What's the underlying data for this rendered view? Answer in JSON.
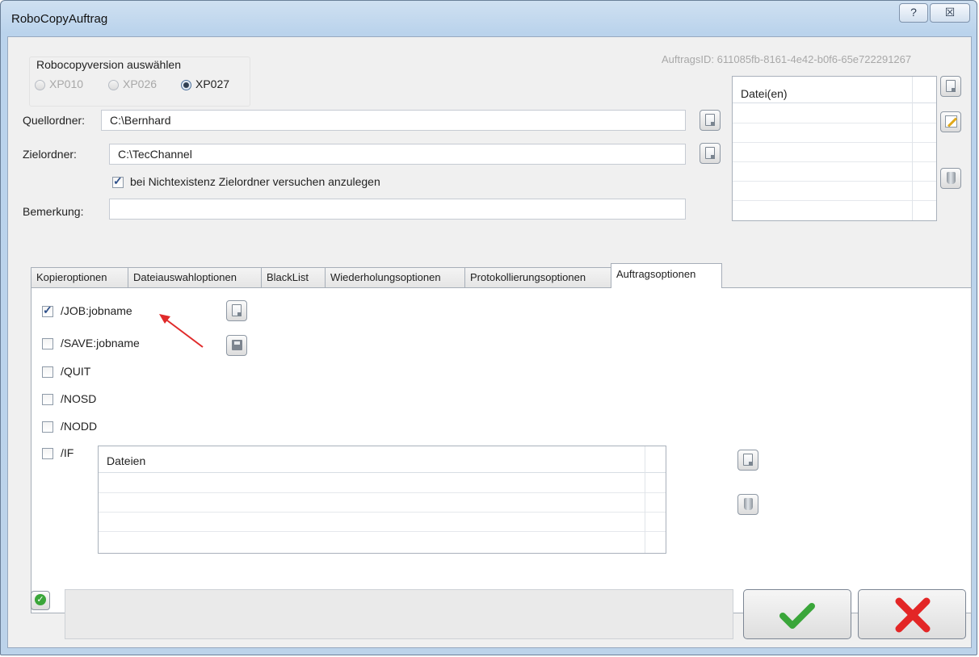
{
  "window": {
    "title": "RoboCopyAuftrag",
    "help_label": "?",
    "close_label": "☒"
  },
  "version": {
    "group_label": "Robocopyversion auswählen",
    "options": [
      "XP010",
      "XP026",
      "XP027"
    ],
    "selected": "XP027"
  },
  "auftrags_id": "AuftragsID: 611085fb-8161-4e42-b0f6-65e722291267",
  "quellordner": {
    "label": "Quellordner:",
    "value": "C:\\Bernhard"
  },
  "zielordner": {
    "label": "Zielordner:",
    "value": "C:\\TecChannel"
  },
  "create_target": {
    "label": "bei Nichtexistenz Zielordner versuchen anzulegen",
    "checked": true
  },
  "bemerkung": {
    "label": "Bemerkung:",
    "value": ""
  },
  "files_grid": {
    "header": "Datei(en)"
  },
  "tabs": [
    "Kopieroptionen",
    "Dateiauswahloptionen",
    "BlackList",
    "Wiederholungsoptionen",
    "Protokollierungsoptionen",
    "Auftragsoptionen"
  ],
  "active_tab": "Auftragsoptionen",
  "options": [
    {
      "label": "/JOB:jobname",
      "checked": true
    },
    {
      "label": "/SAVE:jobname",
      "checked": false
    },
    {
      "label": "/QUIT",
      "checked": false
    },
    {
      "label": "/NOSD",
      "checked": false
    },
    {
      "label": "/NODD",
      "checked": false
    },
    {
      "label": "/IF",
      "checked": false
    }
  ],
  "if_grid": {
    "header": "Dateien"
  },
  "colors": {
    "arrow": "#e02a2a",
    "ok_green": "#3aa63a",
    "cancel_red": "#e32626"
  },
  "icons": [
    "open-file-icon",
    "edit-icon",
    "delete-icon",
    "save-icon",
    "ok-status-icon",
    "checkmark-icon",
    "cross-icon"
  ]
}
